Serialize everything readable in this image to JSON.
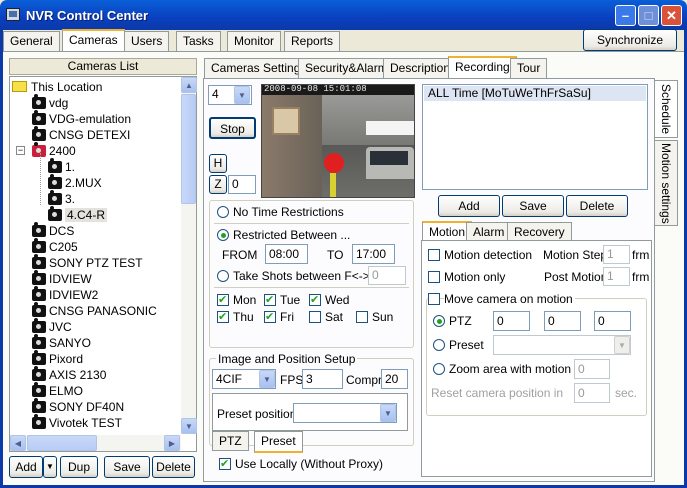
{
  "window": {
    "title": "NVR Control Center",
    "min_glyph": "–",
    "max_glyph": "□",
    "close_glyph": "✕"
  },
  "main_tabs": [
    "General",
    "Cameras",
    "Users",
    "Tasks",
    "Monitor",
    "Reports"
  ],
  "synchronize_label": "Synchronize",
  "cameras_list": {
    "header": "Cameras List",
    "root": "This Location",
    "items": [
      {
        "label": "vdg",
        "indent": 1
      },
      {
        "label": "VDG-emulation",
        "indent": 1
      },
      {
        "label": "CNSG DETEXI",
        "indent": 1
      },
      {
        "label": "2400",
        "indent": 1,
        "group": true,
        "expander": "−"
      },
      {
        "label": "1.",
        "indent": 2
      },
      {
        "label": "2.MUX",
        "indent": 2
      },
      {
        "label": "3.",
        "indent": 2
      },
      {
        "label": "4.C4-R",
        "indent": 2,
        "selected": true
      },
      {
        "label": "DCS",
        "indent": 1
      },
      {
        "label": "C205",
        "indent": 1
      },
      {
        "label": "SONY PTZ TEST",
        "indent": 1
      },
      {
        "label": "IDVIEW",
        "indent": 1
      },
      {
        "label": "IDVIEW2",
        "indent": 1
      },
      {
        "label": "CNSG PANASONIC",
        "indent": 1
      },
      {
        "label": "JVC",
        "indent": 1
      },
      {
        "label": "SANYO",
        "indent": 1
      },
      {
        "label": "Pixord",
        "indent": 1
      },
      {
        "label": "AXIS 2130",
        "indent": 1
      },
      {
        "label": "ELMO",
        "indent": 1
      },
      {
        "label": "SONY DF40N",
        "indent": 1
      },
      {
        "label": "Vivotek TEST",
        "indent": 1
      }
    ],
    "buttons": {
      "add": "Add",
      "dup": "Dup",
      "save": "Save",
      "delete": "Delete"
    }
  },
  "sub_tabs": [
    "Cameras Settings",
    "Security&Alarm",
    "Description",
    "Recording",
    "Tour"
  ],
  "preview": {
    "channel": "4",
    "stop": "Stop",
    "h": "H",
    "z": "Z",
    "z_value": "0",
    "timestamp": "2008-09-08 15:01:08"
  },
  "schedule": {
    "entries": [
      "ALL Time [MoTuWeThFrSaSu]"
    ],
    "add": "Add",
    "save": "Save",
    "delete": "Delete"
  },
  "side_tabs": [
    "Schedule",
    "Motion settings"
  ],
  "time": {
    "no_restrictions": "No Time Restrictions",
    "restricted": "Restricted Between ...",
    "from_label": "FROM",
    "from": "08:00",
    "to_label": "TO",
    "to": "17:00",
    "shots": "Take Shots between F<->T",
    "shots_value": "0"
  },
  "days": [
    {
      "label": "Mon",
      "checked": true
    },
    {
      "label": "Tue",
      "checked": true
    },
    {
      "label": "Wed",
      "checked": true
    },
    {
      "label": "Thu",
      "checked": true
    },
    {
      "label": "Fri",
      "checked": true
    },
    {
      "label": "Sat",
      "checked": false
    },
    {
      "label": "Sun",
      "checked": false
    }
  ],
  "image_setup": {
    "legend": "Image and Position Setup",
    "resolution": "4CIF",
    "fps_label": "FPS",
    "fps": "3",
    "compr_label": "Compr.",
    "compr": "20",
    "preset_label": "Preset position:",
    "tabs": [
      "PTZ",
      "Preset"
    ]
  },
  "use_locally": "Use Locally (Without Proxy)",
  "motion": {
    "tabs": [
      "Motion",
      "Alarm",
      "Recovery"
    ],
    "motion_detection": "Motion detection",
    "motion_only": "Motion only",
    "motion_step_label": "Motion Step",
    "motion_step": "1",
    "post_motion_label": "Post Motion",
    "post_motion": "1",
    "frm": "frm",
    "move_camera": "Move camera on motion",
    "ptz": "PTZ",
    "ptz_values": [
      "0",
      "0",
      "0"
    ],
    "preset": "Preset",
    "zoom": "Zoom area with motion",
    "zoom_value": "0",
    "reset": "Reset camera position in",
    "reset_value": "0",
    "sec": "sec."
  }
}
